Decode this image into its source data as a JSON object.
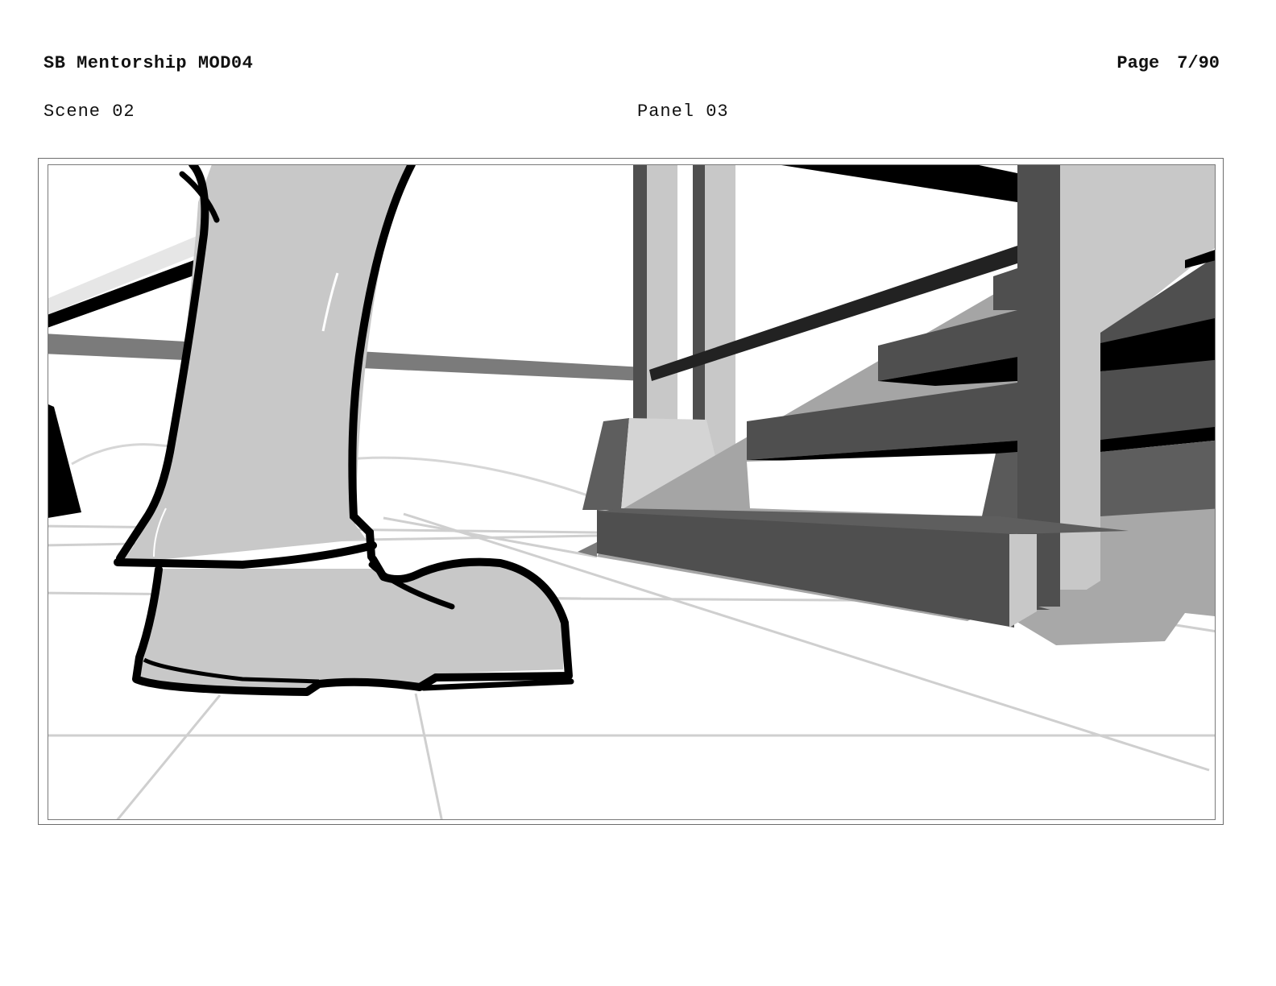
{
  "header": {
    "title": "SB Mentorship MOD04",
    "page_word": "Page",
    "page_number": "7/90"
  },
  "labels": {
    "scene": "Scene 02",
    "panel": "Panel 03"
  },
  "panel_image": {
    "icon": "storyboard-sketch",
    "palette": {
      "ink": "#000000",
      "light_gray": "#c8c8c8",
      "mid_gray": "#7b7b7b",
      "dark_gray": "#4f4f4f",
      "floor_line": "#cfcfcf"
    }
  }
}
